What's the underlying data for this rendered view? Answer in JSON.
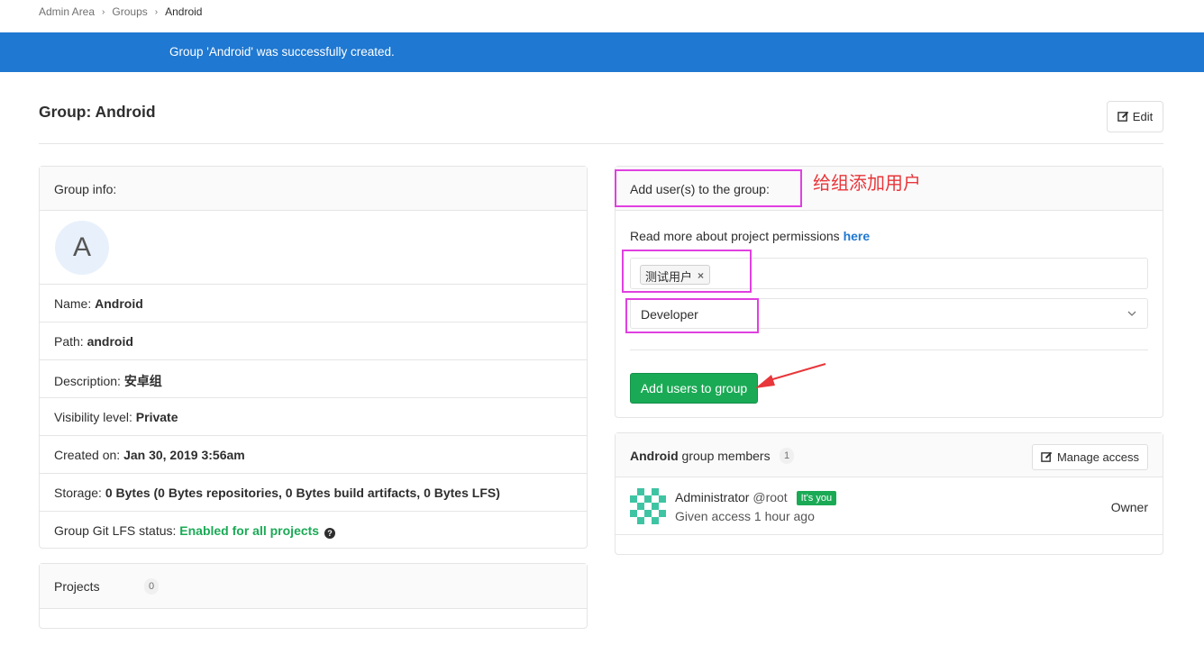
{
  "breadcrumb": [
    "Admin Area",
    "Groups",
    "Android"
  ],
  "flash": "Group 'Android' was successfully created.",
  "page": {
    "title": "Group: Android",
    "edit_label": "Edit"
  },
  "group_info": {
    "header": "Group info:",
    "avatar_letter": "A",
    "rows": [
      {
        "label": "Name:",
        "value": "Android"
      },
      {
        "label": "Path:",
        "value": "android"
      },
      {
        "label": "Description:",
        "value": "安卓组"
      },
      {
        "label": "Visibility level:",
        "value": "Private"
      },
      {
        "label": "Created on:",
        "value": "Jan 30, 2019 3:56am"
      },
      {
        "label": "Storage:",
        "value": "0 Bytes (0 Bytes repositories, 0 Bytes build artifacts, 0 Bytes LFS)"
      },
      {
        "label": "Group Git LFS status:",
        "value": "Enabled for all projects"
      }
    ]
  },
  "projects": {
    "label": "Projects",
    "count": "0"
  },
  "add_users": {
    "header": "Add user(s) to the group:",
    "permissions_text": "Read more about project permissions ",
    "permissions_link": "here",
    "selected_user": "测试用户",
    "remove_symbol": "×",
    "role": "Developer",
    "submit_label": "Add users to group"
  },
  "members": {
    "group_name": "Android",
    "label_suffix": " group members",
    "count": "1",
    "manage_label": "Manage access",
    "list": [
      {
        "name": "Administrator",
        "handle": "@root",
        "badge": "It's you",
        "subtitle": "Given access 1 hour ago",
        "role": "Owner"
      }
    ]
  },
  "annotation": {
    "label": "给组添加用户",
    "color": "#e8363a",
    "box_color": "#e040e0"
  },
  "colors": {
    "flash_bg": "#1f78d1",
    "success": "#1aaa55",
    "link": "#1f78d1"
  }
}
